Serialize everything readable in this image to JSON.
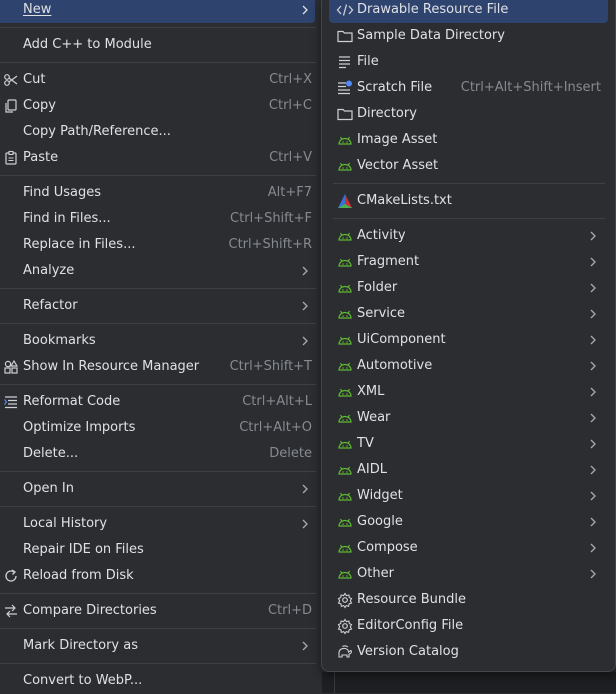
{
  "context_menu": {
    "new_label": "New",
    "add_cpp_label": "Add C++ to Module",
    "cut_label": "Cut",
    "cut_shortcut": "Ctrl+X",
    "copy_label": "Copy",
    "copy_shortcut": "Ctrl+C",
    "copy_path_label": "Copy Path/Reference...",
    "paste_label": "Paste",
    "paste_shortcut": "Ctrl+V",
    "find_usages_label": "Find Usages",
    "find_usages_shortcut": "Alt+F7",
    "find_in_files_label": "Find in Files...",
    "find_in_files_shortcut": "Ctrl+Shift+F",
    "replace_in_files_label": "Replace in Files...",
    "replace_in_files_shortcut": "Ctrl+Shift+R",
    "analyze_label": "Analyze",
    "refactor_label": "Refactor",
    "bookmarks_label": "Bookmarks",
    "show_in_rm_label": "Show In Resource Manager",
    "show_in_rm_shortcut": "Ctrl+Shift+T",
    "reformat_label": "Reformat Code",
    "reformat_shortcut": "Ctrl+Alt+L",
    "optimize_imports_label": "Optimize Imports",
    "optimize_imports_shortcut": "Ctrl+Alt+O",
    "delete_label": "Delete...",
    "delete_shortcut": "Delete",
    "open_in_label": "Open In",
    "local_history_label": "Local History",
    "repair_ide_label": "Repair IDE on Files",
    "reload_label": "Reload from Disk",
    "compare_dirs_label": "Compare Directories",
    "compare_dirs_shortcut": "Ctrl+D",
    "mark_dir_label": "Mark Directory as",
    "convert_webp_label": "Convert to WebP..."
  },
  "new_submenu": {
    "drawable_label": "Drawable Resource File",
    "sample_data_label": "Sample Data Directory",
    "file_label": "File",
    "scratch_label": "Scratch File",
    "scratch_shortcut": "Ctrl+Alt+Shift+Insert",
    "directory_label": "Directory",
    "image_asset_label": "Image Asset",
    "vector_asset_label": "Vector Asset",
    "cmake_label": "CMakeLists.txt",
    "activity_label": "Activity",
    "fragment_label": "Fragment",
    "folder_label": "Folder",
    "service_label": "Service",
    "uicomponent_label": "UiComponent",
    "automotive_label": "Automotive",
    "xml_label": "XML",
    "wear_label": "Wear",
    "tv_label": "TV",
    "aidl_label": "AIDL",
    "widget_label": "Widget",
    "google_label": "Google",
    "compose_label": "Compose",
    "other_label": "Other",
    "resource_bundle_label": "Resource Bundle",
    "editorconfig_label": "EditorConfig File",
    "version_catalog_label": "Version Catalog"
  },
  "colors": {
    "accent": "#2e436e",
    "android_green": "#5fb832",
    "text": "#dfe1e5",
    "muted": "#868a91"
  }
}
